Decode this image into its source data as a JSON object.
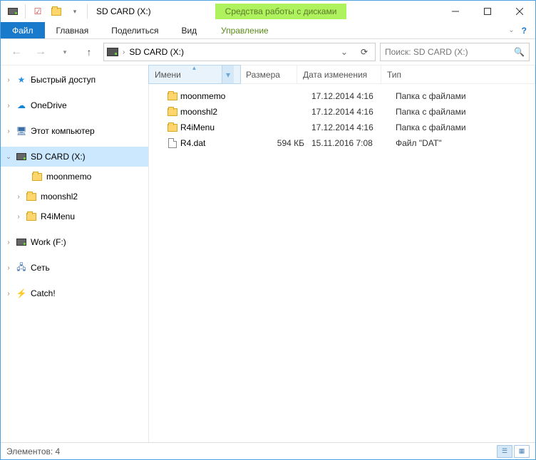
{
  "window": {
    "title": "SD CARD (X:)",
    "tool_tab": "Средства работы с дисками"
  },
  "ribbon": {
    "file": "Файл",
    "home": "Главная",
    "share": "Поделиться",
    "view": "Вид",
    "manage": "Управление"
  },
  "nav_controls": {
    "address": "SD CARD (X:)",
    "search_placeholder": "Поиск: SD CARD (X:)"
  },
  "tree": {
    "quick": "Быстрый доступ",
    "onedrive": "OneDrive",
    "thispc": "Этот компьютер",
    "sdcard": "SD CARD (X:)",
    "sub_moonmemo": "moonmemo",
    "sub_moonshl2": "moonshl2",
    "sub_r4imenu": "R4iMenu",
    "work": "Work (F:)",
    "network": "Сеть",
    "catch": "Catch!"
  },
  "columns": {
    "name": "Имени",
    "size": "Размера",
    "date": "Дата изменения",
    "type": "Тип"
  },
  "files": [
    {
      "name": "moonmemo",
      "size": "",
      "date": "17.12.2014 4:16",
      "type": "Папка с файлами",
      "kind": "folder"
    },
    {
      "name": "moonshl2",
      "size": "",
      "date": "17.12.2014 4:16",
      "type": "Папка с файлами",
      "kind": "folder"
    },
    {
      "name": "R4iMenu",
      "size": "",
      "date": "17.12.2014 4:16",
      "type": "Папка с файлами",
      "kind": "folder"
    },
    {
      "name": "R4.dat",
      "size": "594 КБ",
      "date": "15.11.2016 7:08",
      "type": "Файл \"DAT\"",
      "kind": "file"
    }
  ],
  "status": {
    "count_label": "Элементов: 4"
  }
}
